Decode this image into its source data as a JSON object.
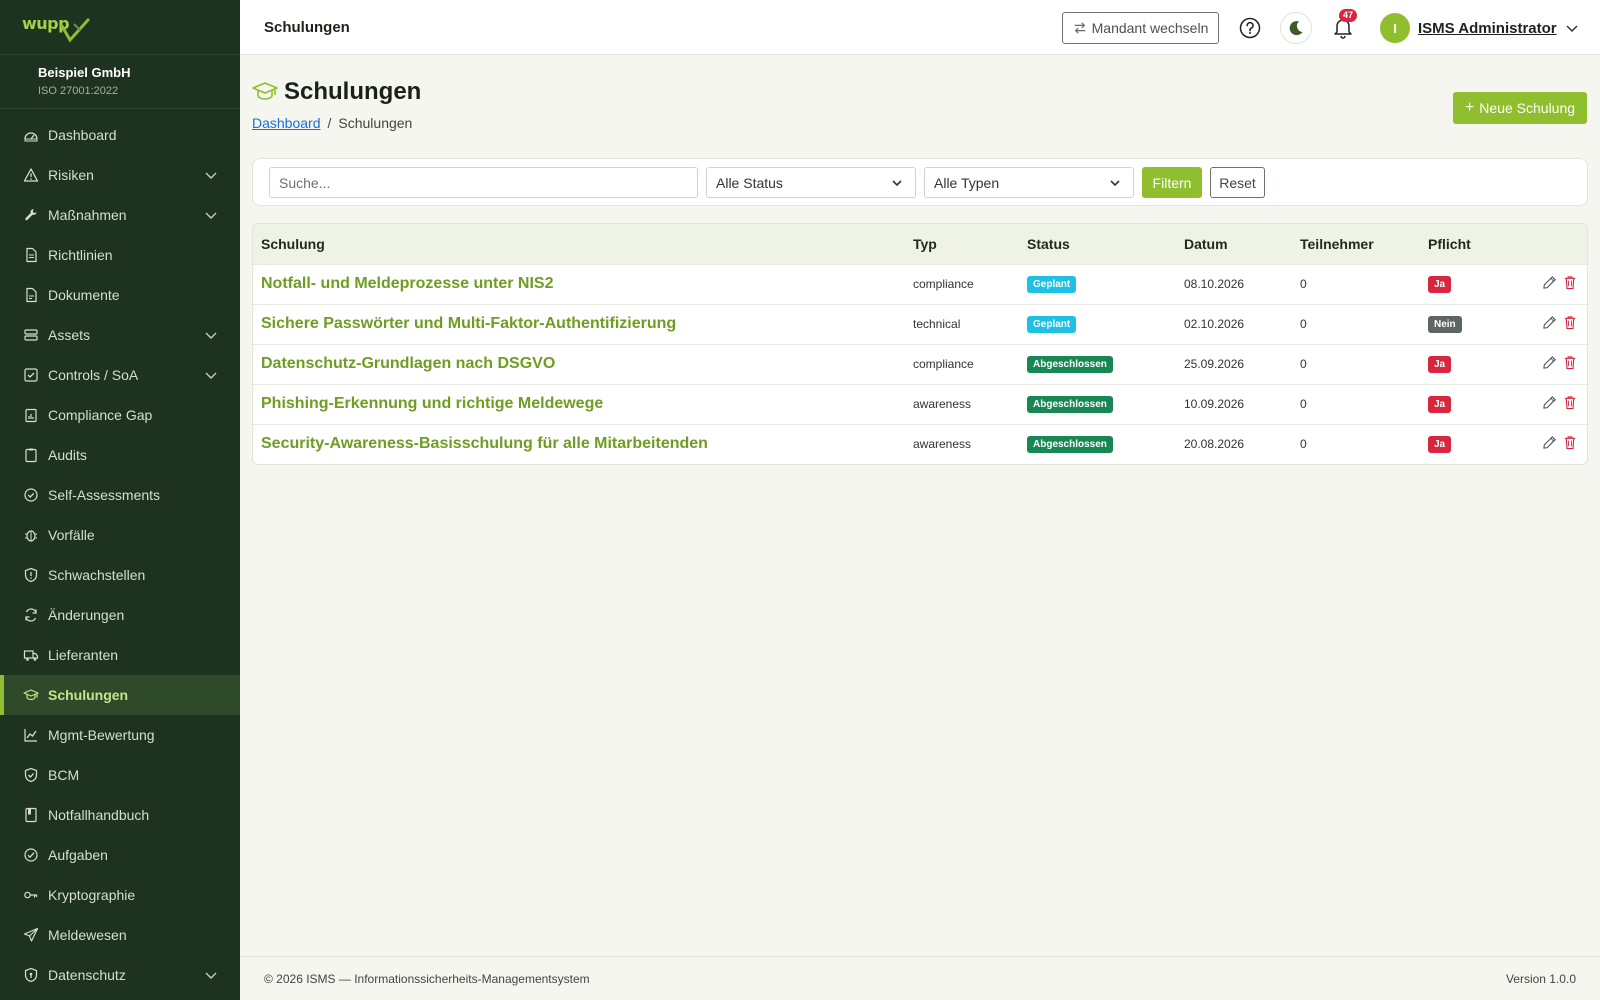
{
  "brand": {
    "logo_text": "wupp"
  },
  "org": {
    "name": "Beispiel GmbH",
    "standard": "ISO 27001:2022"
  },
  "sidebar": {
    "items": [
      {
        "label": "Dashboard",
        "icon": "gauge-icon",
        "expandable": false
      },
      {
        "label": "Risiken",
        "icon": "warning-triangle-icon",
        "expandable": true
      },
      {
        "label": "Maßnahmen",
        "icon": "wrench-icon",
        "expandable": true
      },
      {
        "label": "Richtlinien",
        "icon": "document-icon",
        "expandable": false
      },
      {
        "label": "Dokumente",
        "icon": "file-icon",
        "expandable": false
      },
      {
        "label": "Assets",
        "icon": "server-icon",
        "expandable": true
      },
      {
        "label": "Controls / SoA",
        "icon": "checkbox-icon",
        "expandable": true
      },
      {
        "label": "Compliance Gap",
        "icon": "clipboard-chart-icon",
        "expandable": false
      },
      {
        "label": "Audits",
        "icon": "clipboard-icon",
        "expandable": false
      },
      {
        "label": "Self-Assessments",
        "icon": "check-circle-icon",
        "expandable": false
      },
      {
        "label": "Vorfälle",
        "icon": "bug-icon",
        "expandable": false
      },
      {
        "label": "Schwachstellen",
        "icon": "shield-alert-icon",
        "expandable": false
      },
      {
        "label": "Änderungen",
        "icon": "refresh-icon",
        "expandable": false
      },
      {
        "label": "Lieferanten",
        "icon": "truck-icon",
        "expandable": false
      },
      {
        "label": "Schulungen",
        "icon": "graduation-cap-icon",
        "expandable": false,
        "active": true
      },
      {
        "label": "Mgmt-Bewertung",
        "icon": "trend-chart-icon",
        "expandable": false
      },
      {
        "label": "BCM",
        "icon": "shield-check-icon",
        "expandable": false
      },
      {
        "label": "Notfallhandbuch",
        "icon": "book-icon",
        "expandable": false
      },
      {
        "label": "Aufgaben",
        "icon": "task-check-icon",
        "expandable": false
      },
      {
        "label": "Kryptographie",
        "icon": "key-icon",
        "expandable": false
      },
      {
        "label": "Meldewesen",
        "icon": "send-icon",
        "expandable": false
      },
      {
        "label": "Datenschutz",
        "icon": "shield-lock-icon",
        "expandable": true
      }
    ]
  },
  "header": {
    "page_label": "Schulungen",
    "switch_tenant_label": "Mandant wechseln",
    "notification_count": "47",
    "user_initial": "I",
    "user_name": "ISMS Administrator"
  },
  "page": {
    "title": "Schulungen",
    "breadcrumb": {
      "home": "Dashboard",
      "separator": "/",
      "current": "Schulungen"
    },
    "new_button_label": "Neue Schulung"
  },
  "filters": {
    "search_placeholder": "Suche...",
    "status_selected": "Alle Status",
    "type_selected": "Alle Typen",
    "filter_button": "Filtern",
    "reset_button": "Reset"
  },
  "table": {
    "headers": [
      "Schulung",
      "Typ",
      "Status",
      "Datum",
      "Teilnehmer",
      "Pflicht"
    ],
    "rows": [
      {
        "title": "Notfall- und Meldeprozesse unter NIS2",
        "type": "compliance",
        "status": "Geplant",
        "status_kind": "geplant",
        "date": "08.10.2026",
        "participants": "0",
        "mandatory": "Ja",
        "mandatory_kind": "ja"
      },
      {
        "title": "Sichere Passwörter und Multi-Faktor-Authentifizierung",
        "type": "technical",
        "status": "Geplant",
        "status_kind": "geplant",
        "date": "02.10.2026",
        "participants": "0",
        "mandatory": "Nein",
        "mandatory_kind": "nein"
      },
      {
        "title": "Datenschutz-Grundlagen nach DSGVO",
        "type": "compliance",
        "status": "Abgeschlossen",
        "status_kind": "abg",
        "date": "25.09.2026",
        "participants": "0",
        "mandatory": "Ja",
        "mandatory_kind": "ja"
      },
      {
        "title": "Phishing-Erkennung und richtige Meldewege",
        "type": "awareness",
        "status": "Abgeschlossen",
        "status_kind": "abg",
        "date": "10.09.2026",
        "participants": "0",
        "mandatory": "Ja",
        "mandatory_kind": "ja"
      },
      {
        "title": "Security-Awareness-Basisschulung für alle Mitarbeitenden",
        "type": "awareness",
        "status": "Abgeschlossen",
        "status_kind": "abg",
        "date": "20.08.2026",
        "participants": "0",
        "mandatory": "Ja",
        "mandatory_kind": "ja"
      }
    ]
  },
  "footer": {
    "copyright": "© 2026 ISMS — Informationssicherheits-Managementsystem",
    "version": "Version 1.0.0"
  },
  "colors": {
    "sidebar_bg": "#1e3220",
    "accent": "#8fbf2f",
    "link": "#6e9d22",
    "danger": "#d7263d",
    "info": "#1ec0e6",
    "success": "#198754"
  }
}
